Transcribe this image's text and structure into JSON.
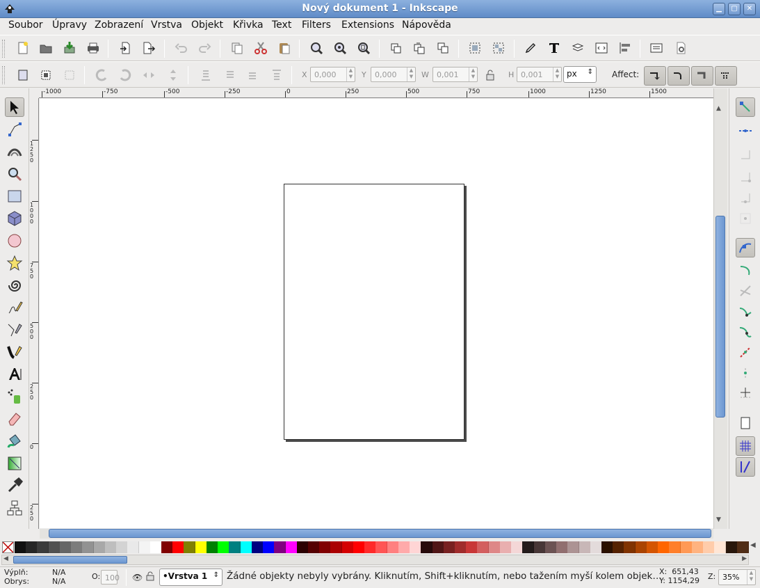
{
  "window": {
    "title": "Nový dokument 1 - Inkscape"
  },
  "menu": [
    "Soubor",
    "Úpravy",
    "Zobrazení",
    "Vrstva",
    "Objekt",
    "Křivka",
    "Text",
    "Filters",
    "Extensions",
    "Nápověda"
  ],
  "controls": {
    "x_label": "X",
    "x_value": "0,000",
    "y_label": "Y",
    "y_value": "0,000",
    "w_label": "W",
    "w_value": "0,001",
    "h_label": "H",
    "h_value": "0,001",
    "unit": "px",
    "affect_label": "Affect:"
  },
  "ruler": {
    "h_labels": [
      "-1000",
      "-750",
      "-500",
      "-250",
      "0",
      "250",
      "500",
      "750",
      "1000",
      "1250",
      "1500"
    ],
    "v_labels": [
      "1\n2\n5\n0",
      "1\n0\n0\n0",
      "7\n5\n0",
      "5\n0\n0",
      "2\n5\n0",
      "0",
      "2\n5\n0"
    ]
  },
  "status": {
    "fill_label": "Výplň:",
    "fill_value": "N/A",
    "stroke_label": "Obrys:",
    "stroke_value": "N/A",
    "opacity_label": "O:",
    "opacity_value": "100",
    "layer": "•Vrstva 1",
    "message": "Žádné objekty nebyly vybrány. Kliknutím, Shift+kliknutím, nebo tažením myší kolem objek…",
    "x_coord": "X:  651,43",
    "y_coord": "Y: 1154,29",
    "zoom_label": "Z:",
    "zoom_value": "35%"
  },
  "palette": [
    "#111111",
    "#262626",
    "#3b3b3b",
    "#515151",
    "#666666",
    "#7c7c7c",
    "#929292",
    "#a8a8a8",
    "#bebebe",
    "#d3d3d3",
    "#e9e9e9",
    "#f4f4f4",
    "#ffffff",
    "#800000",
    "#ff0000",
    "#808000",
    "#ffff00",
    "#008000",
    "#00ff00",
    "#008080",
    "#00ffff",
    "#000080",
    "#0000ff",
    "#800080",
    "#ff00ff",
    "#2b0000",
    "#550000",
    "#800000",
    "#aa0000",
    "#d40000",
    "#ff0000",
    "#ff2a2a",
    "#ff5555",
    "#ff8080",
    "#ffaaaa",
    "#ffd5d5",
    "#280b0b",
    "#501616",
    "#782121",
    "#a02c2c",
    "#c83737",
    "#d35f5f",
    "#de8787",
    "#e9afaf",
    "#f4d7d7",
    "#241c1c",
    "#483737",
    "#6c5353",
    "#916f6f",
    "#ac9393",
    "#c8b7b7",
    "#e3dbdb",
    "#2b1100",
    "#552200",
    "#803300",
    "#aa4400",
    "#d45500",
    "#ff6600",
    "#ff7f2a",
    "#ff9955",
    "#ffb380",
    "#ffccaa",
    "#ffe6d5",
    "#28170b",
    "#502d16"
  ]
}
